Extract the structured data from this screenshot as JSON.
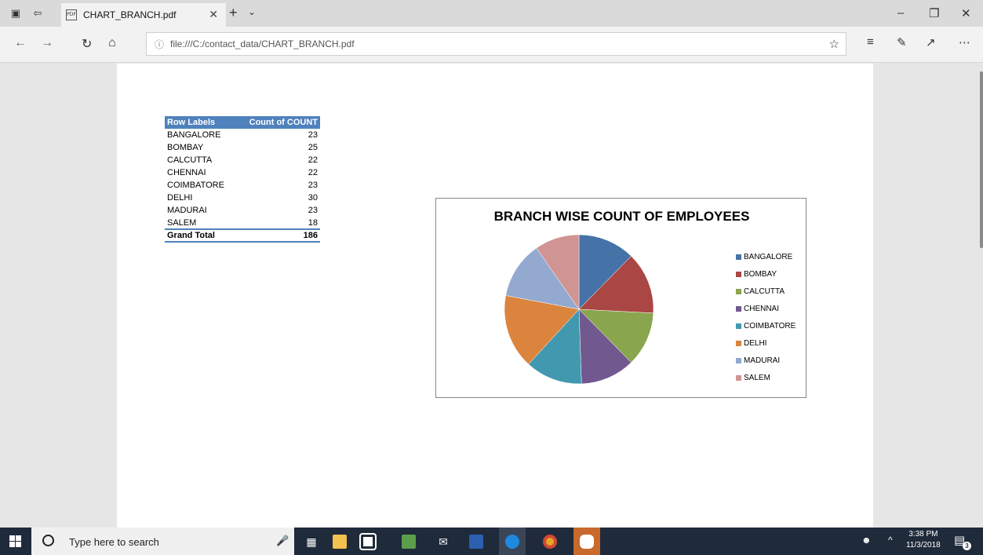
{
  "browser": {
    "tab_title": "CHART_BRANCH.pdf",
    "url": "file:///C:/contact_data/CHART_BRANCH.pdf"
  },
  "pivot": {
    "header_label": "Row Labels",
    "header_count": "Count of COUNT",
    "rows": [
      {
        "label": "BANGALORE",
        "count": "23"
      },
      {
        "label": "BOMBAY",
        "count": "25"
      },
      {
        "label": "CALCUTTA",
        "count": "22"
      },
      {
        "label": "CHENNAI",
        "count": "22"
      },
      {
        "label": "COIMBATORE",
        "count": "23"
      },
      {
        "label": "DELHI",
        "count": "30"
      },
      {
        "label": "MADURAI",
        "count": "23"
      },
      {
        "label": "SALEM",
        "count": "18"
      }
    ],
    "total_label": "Grand Total",
    "total_count": "186"
  },
  "chart_data": {
    "type": "pie",
    "title": "BRANCH WISE COUNT OF EMPLOYEES",
    "categories": [
      "BANGALORE",
      "BOMBAY",
      "CALCUTTA",
      "CHENNAI",
      "COIMBATORE",
      "DELHI",
      "MADURAI",
      "SALEM"
    ],
    "values": [
      23,
      25,
      22,
      22,
      23,
      30,
      23,
      18
    ],
    "colors": [
      "#4572a7",
      "#aa4643",
      "#89a54e",
      "#71588f",
      "#4198af",
      "#db843d",
      "#93a9cf",
      "#d09493"
    ],
    "legend": "right"
  },
  "taskbar": {
    "search_placeholder": "Type here to search",
    "time": "3:38 PM",
    "date": "11/3/2018",
    "notification_count": "3"
  }
}
